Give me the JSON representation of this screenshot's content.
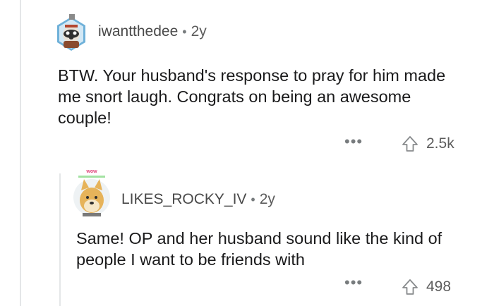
{
  "comments": [
    {
      "username": "iwantthedee",
      "separator": "•",
      "age": "2y",
      "text": "BTW. Your husband's response to pray for him made me snort laugh. Congrats on being an awesome couple!",
      "more_label": "•••",
      "upvotes": "2.5k",
      "avatar_icon": "snoo-raccoon-avatar-icon"
    },
    {
      "username": "LIKES_ROCKY_IV",
      "separator": "•",
      "age": "2y",
      "text": "Same! OP and her husband sound like the kind of people I want to be friends with",
      "more_label": "•••",
      "upvotes": "498",
      "avatar_icon": "doge-avatar-icon",
      "avatar_caption": "wow"
    }
  ]
}
